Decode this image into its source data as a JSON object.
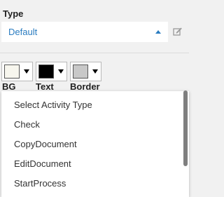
{
  "type_field": {
    "label": "Type",
    "selected_value": "Default",
    "value_color": "#2a7cc0",
    "icons": {
      "caret": "caret-up-icon",
      "edit": "edit-icon"
    }
  },
  "colors": [
    {
      "label": "BG",
      "swatch": "#f7f6ee",
      "icon": "chevron-down-icon"
    },
    {
      "label": "Text",
      "swatch": "#000000",
      "icon": "chevron-down-icon"
    },
    {
      "label": "Border",
      "swatch": "#c8c8c8",
      "icon": "chevron-down-icon"
    }
  ],
  "dropdown": {
    "options": [
      "Select Activity Type",
      "Check",
      "CopyDocument",
      "EditDocument",
      "StartProcess"
    ]
  }
}
